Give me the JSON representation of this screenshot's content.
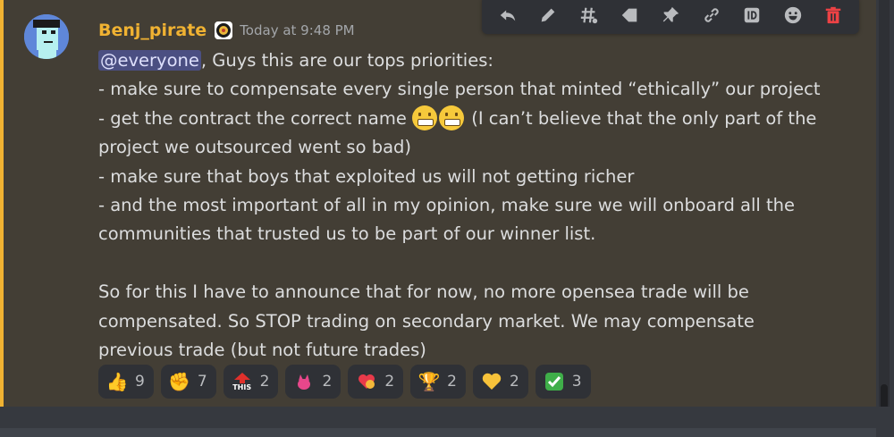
{
  "message": {
    "author": "Benj_pirate",
    "timestamp": "Today at 9:48 PM",
    "mention": "@everyone",
    "lines": [
      ", Guys this are our tops priorities:",
      "- make sure to compensate every single person that minted “ethically” our project",
      "- get the contract the correct name ",
      " (I can’t believe that the only part of the",
      "project we outsourced went so bad)",
      "- make sure that boys that exploited us will not getting richer",
      "- and the most important of all in my opinion, make sure we will onboard all the",
      "communities that trusted us to be part of our winner list.",
      "So for this I have to announce that for now, no more opensea trade will be",
      "compensated. So STOP trading on secondary market. We may compensate",
      "previous trade (but not future trades)"
    ],
    "inline_emojis": [
      "grimacing-face-emoji",
      "grimacing-face-emoji"
    ]
  },
  "reactions": [
    {
      "emoji": "thumbs-up",
      "glyph": "👍",
      "count": "9"
    },
    {
      "emoji": "raised-fist",
      "glyph": "✊",
      "count": "7"
    },
    {
      "emoji": "this-arrow",
      "glyph": "",
      "label": "THIS",
      "count": "2"
    },
    {
      "emoji": "pink-cat",
      "glyph": "🐱",
      "count": "2"
    },
    {
      "emoji": "heart-hug",
      "glyph": "💖",
      "count": "2"
    },
    {
      "emoji": "trophy",
      "glyph": "🏆",
      "count": "2"
    },
    {
      "emoji": "yellow-heart",
      "glyph": "💛",
      "count": "2"
    },
    {
      "emoji": "check-mark",
      "glyph": "✅",
      "count": "3"
    }
  ],
  "toolbar": [
    "reply-icon",
    "edit-icon",
    "thread-icon",
    "tag-icon",
    "pin-icon",
    "link-icon",
    "copy-id-icon",
    "add-reaction-icon",
    "delete-icon"
  ],
  "colors": {
    "username": "#f0b232",
    "highlight_bg": "#433e35",
    "mention_bg": "#4b4f82",
    "delete": "#ed4245"
  }
}
